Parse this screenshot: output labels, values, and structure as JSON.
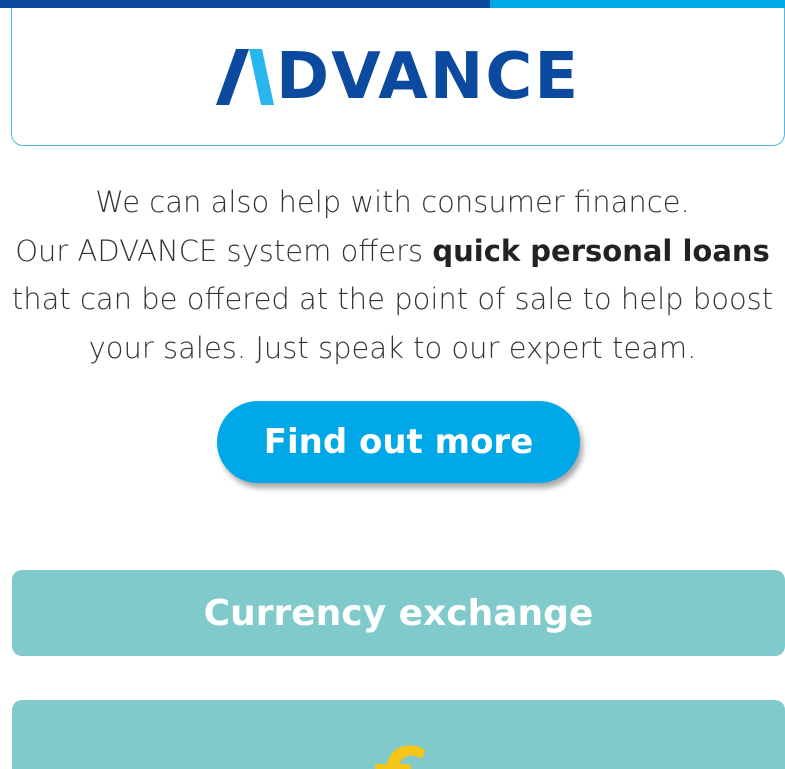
{
  "brand": {
    "logo_text": "DVANCE",
    "logo_alt": "ADVANCE",
    "colors": {
      "dark_blue": "#0b4a9e",
      "light_blue": "#00a8e8",
      "teal": "#80cacb",
      "euro_gold": "#f5c518"
    }
  },
  "body": {
    "line1": "We can also help with consumer finance.",
    "line2_prefix": "Our ADVANCE system offers ",
    "line2_bold": "quick personal loans",
    "line3": "that can be offered at the point of sale to help boost",
    "line4": "your sales. Just speak to our expert team."
  },
  "cta": {
    "label": "Find out more"
  },
  "sections": {
    "currency_label": "Currency exchange",
    "next_icon": "euro-icon"
  }
}
